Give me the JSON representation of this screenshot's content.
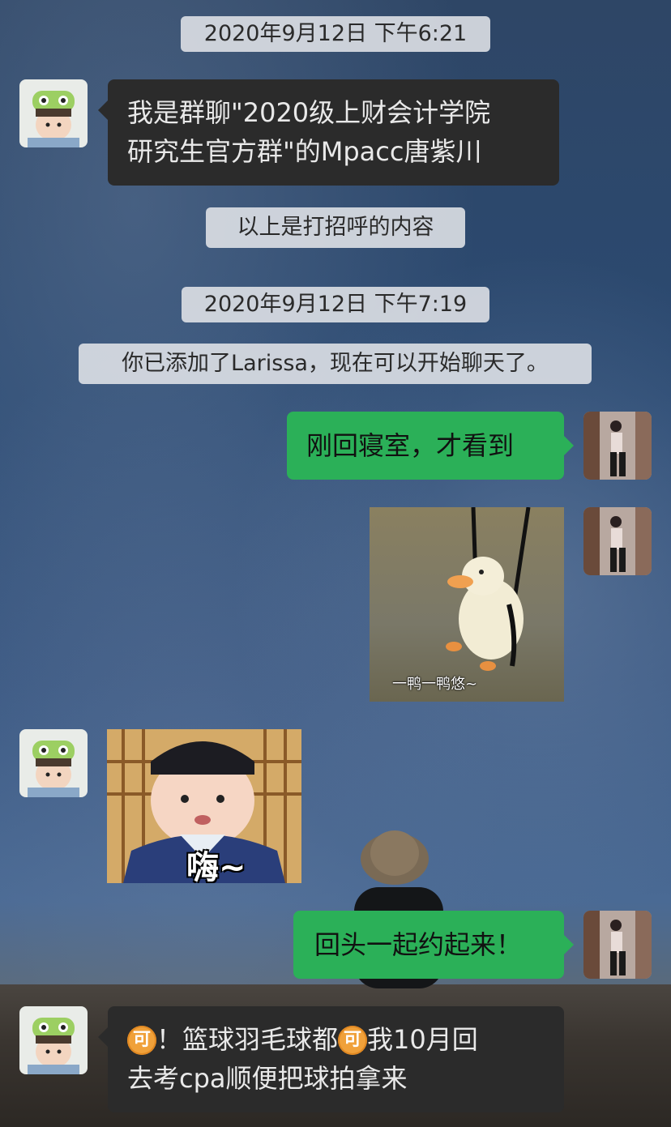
{
  "messages": {
    "time1": "2020年9月12日 下午6:21",
    "greeting_line1": "我是群聊\"2020级上财会计学院",
    "greeting_line2": "研究生官方群\"的Mpacc唐紫川",
    "notice_greeting": "以上是打招呼的内容",
    "time2": "2020年9月12日 下午7:19",
    "notice_added": "你已添加了Larissa，现在可以开始聊天了。",
    "reply1": "刚回寝室，才看到",
    "duck_caption": "一鸭一鸭悠~",
    "hai_caption": "嗨~",
    "reply2": "回头一起约起来！",
    "last_ke": "可",
    "last_part1": "！篮球羽毛球都",
    "last_part2": "我10月回",
    "last_line2": "去考cpa顺便把球拍拿来"
  },
  "colors": {
    "green_bubble": "#2bb058",
    "dark_bubble": "#2b2b2b",
    "system_pill": "#e1e4e8"
  },
  "icons": {
    "contact_avatar": "cartoon-child-avatar",
    "self_avatar": "person-photo-avatar"
  }
}
